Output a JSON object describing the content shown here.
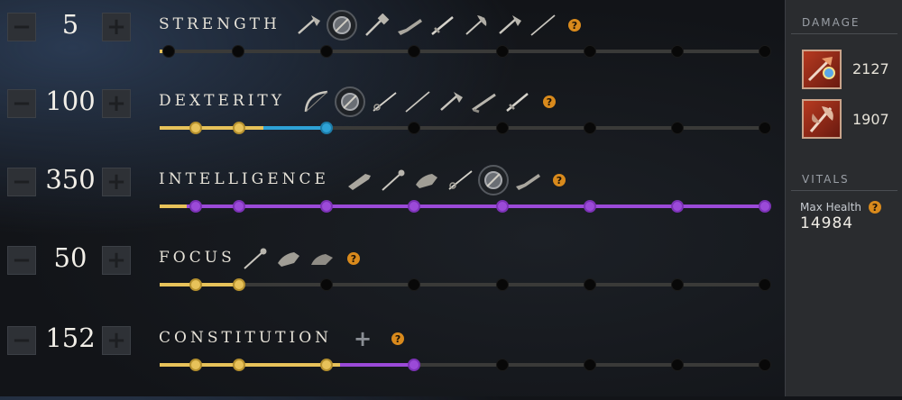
{
  "attributes": [
    {
      "key": "strength",
      "name": "STRENGTH",
      "value": "5",
      "fill_points": 0,
      "fill_colors": [],
      "icon_count": 9,
      "icons": [
        "hatchet-icon",
        "round-shield-icon",
        "war-hammer-icon",
        "blunderbuss-icon",
        "sword-icon",
        "great-axe-icon",
        "hatchet-icon",
        "spear-icon",
        "musket-icon"
      ]
    },
    {
      "key": "dexterity",
      "name": "DEXTERITY",
      "value": "100",
      "fill_points": 100,
      "fill_colors": [
        "gold",
        "gold",
        "blue"
      ],
      "icon_count": 8,
      "icons": [
        "bow-icon",
        "round-shield-icon",
        "rapier-icon",
        "spear-icon",
        "hatchet-icon",
        "musket-icon",
        "sword-icon",
        "dagger-icon"
      ]
    },
    {
      "key": "intelligence",
      "name": "INTELLIGENCE",
      "value": "350",
      "fill_points": 350,
      "fill_colors": [
        "purple",
        "purple",
        "purple",
        "purple",
        "purple",
        "purple",
        "purple",
        "purple"
      ],
      "icon_count": 7,
      "icons": [
        "fire-staff-icon",
        "life-staff-icon",
        "void-gauntlet-icon",
        "rapier-icon",
        "round-shield-icon",
        "blunderbuss-icon"
      ]
    },
    {
      "key": "focus",
      "name": "FOCUS",
      "value": "50",
      "fill_points": 50,
      "fill_colors": [
        "gold",
        "gold"
      ],
      "icon_count": 3,
      "icons": [
        "life-staff-icon",
        "void-gauntlet-icon",
        "ice-gauntlet-icon"
      ]
    },
    {
      "key": "constitution",
      "name": "CONSTITUTION",
      "value": "152",
      "fill_points": 152,
      "fill_colors": [
        "gold",
        "gold",
        "gold",
        "purple"
      ],
      "icon_count": 0,
      "icons": []
    }
  ],
  "help_glyph": "?",
  "plus_glyph": "+",
  "minus_glyph": "−",
  "constitution_badge": "+",
  "sidebar": {
    "damage_heading": "DAMAGE",
    "damage": [
      {
        "icon": "fire-staff-icon",
        "value": "2127"
      },
      {
        "icon": "great-axe-icon",
        "value": "1907"
      }
    ],
    "vitals_heading": "VITALS",
    "vitals": {
      "label": "Max Health",
      "value": "14984"
    }
  },
  "colors": {
    "gold": "#e7c25a",
    "blue": "#2ea2d6",
    "purple": "#9b4ad8",
    "help": "#d98a1c"
  }
}
